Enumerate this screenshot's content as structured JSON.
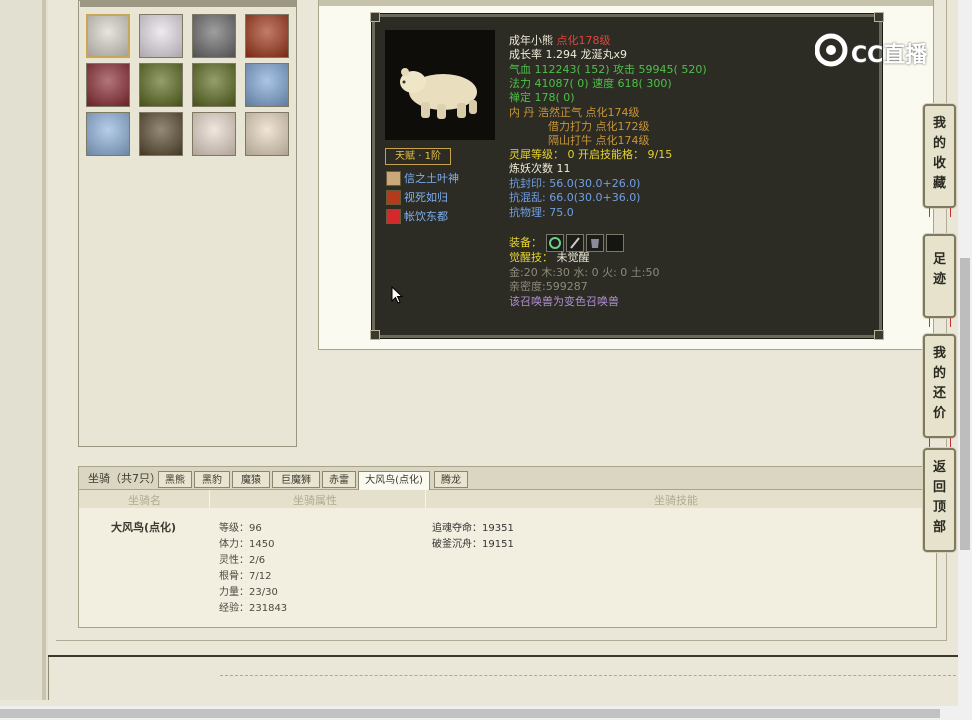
{
  "logo": {
    "text": "CC直播"
  },
  "pets": [
    {
      "icon": "polar-bear-icon",
      "bg": "#d9d6cc",
      "selected": true
    },
    {
      "icon": "fox-girl-icon",
      "bg": "#e6dfe6"
    },
    {
      "icon": "stone-beast-icon",
      "bg": "#6b6b6b"
    },
    {
      "icon": "fire-spirit-icon",
      "bg": "#a0361a"
    },
    {
      "icon": "red-hair-girl-icon",
      "bg": "#8a2b33"
    },
    {
      "icon": "green-ogre-icon",
      "bg": "#5c6a1e"
    },
    {
      "icon": "green-ogre-icon",
      "bg": "#5c6a1e"
    },
    {
      "icon": "ice-golem-icon",
      "bg": "#7ea6d6"
    },
    {
      "icon": "ice-golem-icon",
      "bg": "#8fb3dc"
    },
    {
      "icon": "dragon-icon",
      "bg": "#5a4a2e"
    },
    {
      "icon": "flower-girl-icon",
      "bg": "#e9d9cc"
    },
    {
      "icon": "black-hair-girl-icon",
      "bg": "#e8d8c0"
    }
  ],
  "detail": {
    "name": "成年小熊",
    "enhance": "点化178级",
    "growth": "成长率 1.294 龙涎丸x9",
    "hp": "气血 112243( 152) 攻击 59945( 520)",
    "mp": "法力 41087( 0) 速度 618( 300)",
    "focus": "禅定 178( 0)",
    "inner1": "内   丹 浩然正气 点化174级",
    "inner2": "借力打力 点化172级",
    "inner3": "隔山打牛 点化174级",
    "spirit": "灵犀等级： 0 开启技能格： 9/15",
    "refine": "炼妖次数 11",
    "resist_seal": "抗封印: 56.0(30.0+26.0)",
    "resist_chaos": "抗混乱: 66.0(30.0+36.0)",
    "resist_phys": "抗物理: 75.0",
    "equip_label": "装备：",
    "awaken_label": "觉醒技：",
    "awaken_value": "未觉醒",
    "elements": "金:20 木:30 水: 0 火: 0 土:50",
    "intimacy": "亲密度:599287",
    "note": "该召唤兽为变色召唤兽",
    "talent": "天赋 · 1阶",
    "skills": [
      {
        "name": "信之土叶神",
        "icon": "earth-god-icon",
        "color": "#c9a87a"
      },
      {
        "name": "视死如归",
        "icon": "skull-fire-icon",
        "color": "#b33a1a"
      },
      {
        "name": "帐饮东都",
        "icon": "red-orb-icon",
        "color": "#d22a2a"
      }
    ]
  },
  "mount": {
    "title": "坐骑（共7只）",
    "tabs": [
      "黑熊",
      "黑豹",
      "魔猿",
      "巨魔狮",
      "赤雷",
      "大风鸟(点化)",
      "腾龙"
    ],
    "active_tab": 5,
    "headers": {
      "name": "坐骑名",
      "attr": "坐骑属性",
      "skill": "坐骑技能"
    },
    "name": "大风鸟(点化)",
    "stats": [
      "等级：96",
      "体力：1450",
      "灵性：2/6",
      "根骨：7/12",
      "力量：23/30",
      "经验：231843"
    ],
    "skills": [
      "追魂夺命：19351",
      "破釜沉舟：19151"
    ]
  },
  "side": [
    {
      "label": "我的收藏",
      "chars": [
        "我",
        "的",
        "收",
        "藏"
      ]
    },
    {
      "label": "足迹",
      "chars": [
        "足",
        "迹"
      ]
    },
    {
      "label": "我的还价",
      "chars": [
        "我",
        "的",
        "还",
        "价"
      ]
    },
    {
      "label": "返回顶部",
      "chars": [
        "返",
        "回",
        "顶",
        "部"
      ]
    }
  ]
}
